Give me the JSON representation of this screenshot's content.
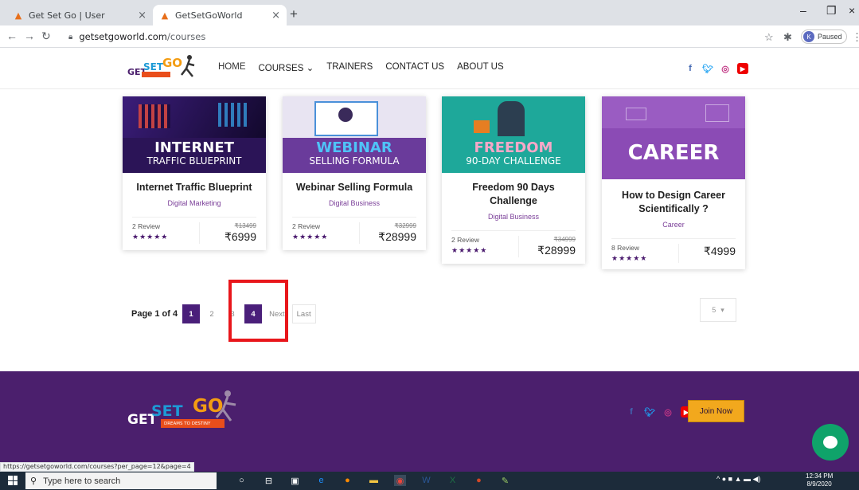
{
  "browser": {
    "tabs": [
      {
        "title": "Get Set Go | User"
      },
      {
        "title": "GetSetGoWorld"
      }
    ],
    "new_tab": "+",
    "url_domain": "getsetgoworld.com",
    "url_path": "/courses",
    "profile_initial": "K",
    "profile_status": "Paused",
    "status_url": "https://getsetgoworld.com/courses?per_page=12&page=4"
  },
  "header": {
    "nav": [
      {
        "label": "HOME"
      },
      {
        "label": "COURSES ⌄"
      },
      {
        "label": "TRAINERS"
      },
      {
        "label": "CONTACT US"
      },
      {
        "label": "ABOUT US"
      }
    ],
    "social_icons": [
      "facebook-icon",
      "twitter-icon",
      "instagram-icon",
      "youtube-icon"
    ]
  },
  "courses": [
    {
      "banner_line1": "INTERNET",
      "banner_line2": "TRAFFIC BLUEPRINT",
      "title": "Internet Traffic Blueprint",
      "category": "Digital Marketing",
      "reviews": "2 Review",
      "stars": "★★★★★",
      "old_price": "₹13499",
      "price": "₹6999",
      "banner_color": "#2b1457"
    },
    {
      "banner_line1": "WEBINAR",
      "banner_line2": "SELLING FORMULA",
      "title": "Webinar Selling Formula",
      "category": "Digital Business",
      "reviews": "2 Review",
      "stars": "★★★★★",
      "old_price": "₹32999",
      "price": "₹28999",
      "banner_color": "#5e2b86"
    },
    {
      "banner_line1": "FREEDOM",
      "banner_line2": "90-DAY CHALLENGE",
      "title": "Freedom 90 Days Challenge",
      "category": "Digital Business",
      "reviews": "2 Review",
      "stars": "★★★★★",
      "old_price": "₹34999",
      "price": "₹28999",
      "banner_color": "#1ea89a"
    },
    {
      "banner_line1": "CAREER",
      "banner_line2": "",
      "title": "How to Design Career Scientifically ?",
      "category": "Career",
      "reviews": "8 Review",
      "stars": "★★★★★",
      "old_price": "",
      "price": "₹4999",
      "banner_color": "#8b4bb5"
    }
  ],
  "pagination": {
    "label": "Page 1 of 4",
    "pages": [
      "1",
      "2",
      "3",
      "4"
    ],
    "next": "Next",
    "last": "Last",
    "per_page": "5",
    "current_page": 1,
    "highlighted_page": 4
  },
  "footer": {
    "join_label": "Join Now",
    "logo_tagline": "DREAMS TO DESTINY"
  },
  "taskbar": {
    "search_placeholder": "Type here to search",
    "time": "12:34 PM",
    "date": "8/9/2020"
  },
  "colors": {
    "brand_purple": "#4b1f6d",
    "accent_orange": "#f2a81d",
    "highlight_red": "#e8161b"
  }
}
